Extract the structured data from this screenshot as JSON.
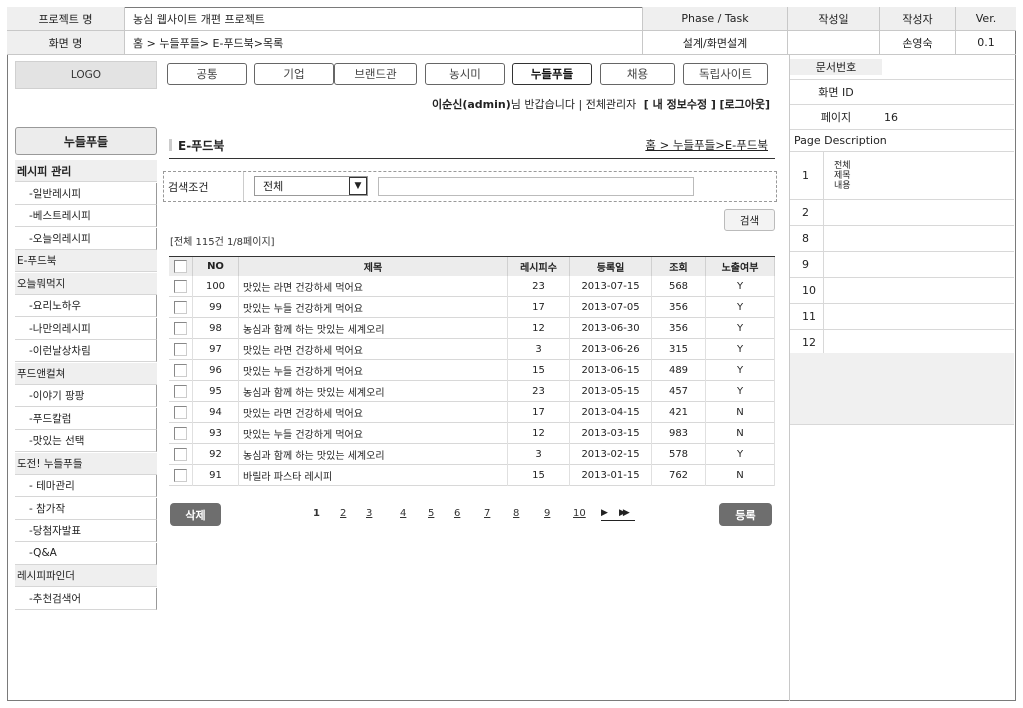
{
  "header": {
    "project_label": "프로젝트 명",
    "project_value": "농심 웹사이트 개편 프로젝트",
    "phase_label": "Phase / Task",
    "created_label": "작성일",
    "author_label": "작성자",
    "ver_label": "Ver.",
    "screen_label": "화면 명",
    "screen_value": "홈 > 누들푸들> E-푸드북>목록",
    "phase_value": "설계/화면설계",
    "created_value": "",
    "author_value": "손영숙",
    "ver_value": "0.1"
  },
  "logo": "LOGO",
  "nav": {
    "tabs": [
      "공통",
      "기업",
      "브랜드관",
      "농시미",
      "누들푸들",
      "채용",
      "독립사이트"
    ],
    "active_index": 4
  },
  "user_bar": {
    "greeting_name": "이순신(admin)",
    "greeting_rest": "님 반갑습니다 | 전체관리자",
    "edit_info": "[ 내 정보수정 ]",
    "logout": "[로그아웃]"
  },
  "sidebar": {
    "title": "누들푸들",
    "items": [
      {
        "label": "레시피 관리",
        "type": "cat",
        "bold": true
      },
      {
        "label": "-일반레시피",
        "type": "sub"
      },
      {
        "label": "-베스트레시피",
        "type": "sub"
      },
      {
        "label": "-오늘의레시피",
        "type": "sub"
      },
      {
        "label": "E-푸드북",
        "type": "cat"
      },
      {
        "label": "오늘뭐먹지",
        "type": "cat"
      },
      {
        "label": "-요리노하우",
        "type": "sub"
      },
      {
        "label": "-나만의레시피",
        "type": "sub"
      },
      {
        "label": "-이런날상차림",
        "type": "sub"
      },
      {
        "label": "푸드앤컬쳐",
        "type": "cat"
      },
      {
        "label": "-이야기 팡팡",
        "type": "sub"
      },
      {
        "label": "-푸드칼럼",
        "type": "sub"
      },
      {
        "label": "-맛있는 선택",
        "type": "sub"
      },
      {
        "label": "도전! 누들푸들",
        "type": "cat"
      },
      {
        "label": "- 테마관리",
        "type": "sub"
      },
      {
        "label": "- 참가작",
        "type": "sub"
      },
      {
        "label": "-당첨자발표",
        "type": "sub"
      },
      {
        "label": "-Q&A",
        "type": "sub"
      },
      {
        "label": "레시피파인더",
        "type": "cat"
      },
      {
        "label": "-추천검색어",
        "type": "sub"
      }
    ]
  },
  "content": {
    "title": "E-푸드북",
    "breadcrumb": "홈 > 누들푸들>E-푸드북",
    "search": {
      "label": "검색조건",
      "select_value": "전체",
      "input_value": "",
      "button": "검색"
    },
    "count_text": "[전체 115건  1/8페이지]",
    "columns": [
      "NO",
      "제목",
      "레시피수",
      "등록일",
      "조회",
      "노출여부"
    ],
    "rows": [
      {
        "no": "100",
        "title": "맛있는 라면 건강하세 먹어요",
        "recipes": "23",
        "date": "2013-07-15",
        "views": "568",
        "visible": "Y"
      },
      {
        "no": "99",
        "title": "맛있는 누들 건강하게 먹어요",
        "recipes": "17",
        "date": "2013-07-05",
        "views": "356",
        "visible": "Y"
      },
      {
        "no": "98",
        "title": "농심과 함께 하는 맛있는 세계오리",
        "recipes": "12",
        "date": "2013-06-30",
        "views": "356",
        "visible": "Y"
      },
      {
        "no": "97",
        "title": "맛있는 라면 건강하세 먹어요",
        "recipes": "3",
        "date": "2013-06-26",
        "views": "315",
        "visible": "Y"
      },
      {
        "no": "96",
        "title": "맛있는 누들 건강하게 먹어요",
        "recipes": "15",
        "date": "2013-06-15",
        "views": "489",
        "visible": "Y"
      },
      {
        "no": "95",
        "title": "농심과 함께 하는 맛있는 세계오리",
        "recipes": "23",
        "date": "2013-05-15",
        "views": "457",
        "visible": "Y"
      },
      {
        "no": "94",
        "title": "맛있는 라면 건강하세 먹어요",
        "recipes": "17",
        "date": "2013-04-15",
        "views": "421",
        "visible": "N"
      },
      {
        "no": "93",
        "title": "맛있는 누들 건강하게 먹어요",
        "recipes": "12",
        "date": "2013-03-15",
        "views": "983",
        "visible": "N"
      },
      {
        "no": "92",
        "title": "농심과 함께 하는 맛있는 세계오리",
        "recipes": "3",
        "date": "2013-02-15",
        "views": "578",
        "visible": "Y"
      },
      {
        "no": "91",
        "title": "바릴라 파스타 레시피",
        "recipes": "15",
        "date": "2013-01-15",
        "views": "762",
        "visible": "N"
      }
    ],
    "delete_button": "삭제",
    "register_button": "등록",
    "pages": [
      "1",
      "2",
      "3",
      "4",
      "5",
      "6",
      "7",
      "8",
      "9",
      "10"
    ],
    "current_page": "1"
  },
  "right_panel": {
    "doc_no_label": "문서번호",
    "doc_no_value": "",
    "screen_id_label": "화면 ID",
    "screen_id_value": "",
    "page_label": "페이지",
    "page_value": "16",
    "desc_title": "Page Description",
    "desc_rows": [
      {
        "num": "1",
        "text": "전체\n제목\n내용"
      },
      {
        "num": "2",
        "text": ""
      },
      {
        "num": "8",
        "text": ""
      },
      {
        "num": "9",
        "text": ""
      },
      {
        "num": "10",
        "text": ""
      },
      {
        "num": "11",
        "text": ""
      },
      {
        "num": "12",
        "text": ""
      }
    ]
  },
  "colors": {
    "border": "#7a7a7a",
    "header_gray": "#efefef",
    "button_dark": "#6e6e6e"
  }
}
